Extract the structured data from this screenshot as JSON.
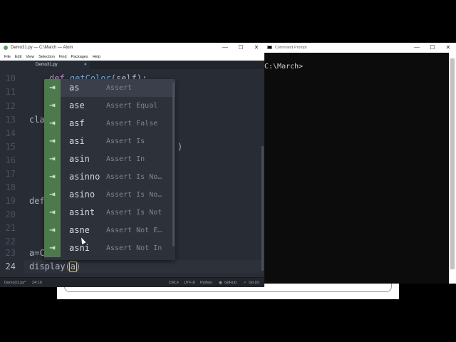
{
  "atom": {
    "title": "Demo31.py — C:\\March — Atom",
    "window_buttons": [
      "—",
      "☐",
      "✕"
    ],
    "menu": [
      "File",
      "Edit",
      "View",
      "Selection",
      "Find",
      "Packages",
      "Help"
    ],
    "tab": "Demo31.py",
    "line_numbers": [
      "10",
      "11",
      "12",
      "13",
      "14",
      "15",
      "16",
      "17",
      "18",
      "19",
      "20",
      "21",
      "22",
      "23",
      "24"
    ],
    "code": {
      "l10_kw": "def",
      "l10_fn": "getColor",
      "l10_rest": "(self):",
      "l13": "cla",
      "l15_tail": ")",
      "l19": "def",
      "l23": "a=C",
      "l24_pre": "display(",
      "l24_cursor": "a",
      "l24_post": ")"
    },
    "status": {
      "file": "Demo31.py*",
      "pos": "24:10",
      "eol": "CRLF",
      "encoding": "UTF-8",
      "grammar": "Python",
      "github": "GitHub",
      "git": "Git (0)"
    }
  },
  "autocomplete": {
    "items": [
      {
        "text": "as",
        "desc": "Assert"
      },
      {
        "text": "ase",
        "desc": "Assert Equal"
      },
      {
        "text": "asf",
        "desc": "Assert False"
      },
      {
        "text": "asi",
        "desc": "Assert Is"
      },
      {
        "text": "asin",
        "desc": "Assert In"
      },
      {
        "text": "asinno",
        "desc": "Assert Is No…"
      },
      {
        "text": "asino",
        "desc": "Assert Is No…"
      },
      {
        "text": "asint",
        "desc": "Assert Is Not"
      },
      {
        "text": "asne",
        "desc": "Assert Not E…"
      },
      {
        "text": "asni",
        "desc": "Assert Not In"
      }
    ],
    "icon": "snippet-arrow-icon",
    "icon_glyph": "⇥"
  },
  "cmd": {
    "title": "Command Prompt",
    "window_buttons": [
      "—",
      "☐",
      "✕"
    ],
    "prompt": "C:\\March>"
  }
}
